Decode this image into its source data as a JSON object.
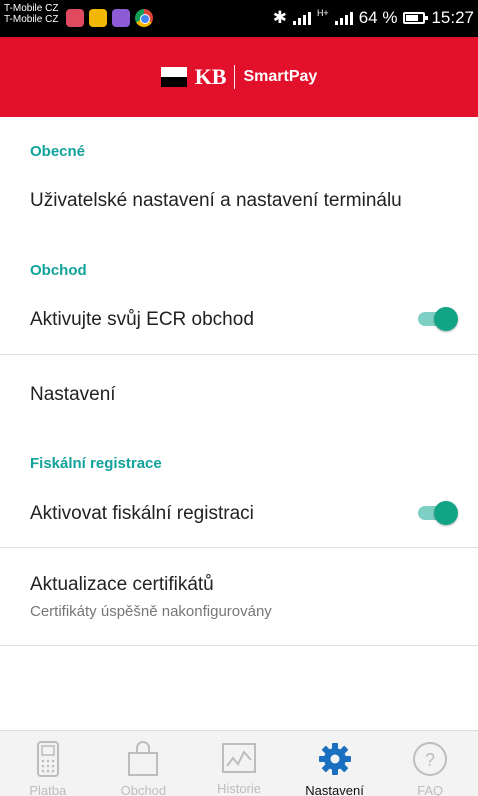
{
  "status_bar": {
    "carrier1": "T-Mobile CZ",
    "carrier2": "T-Mobile CZ",
    "network": "H+",
    "battery": "64 %",
    "battery_level": 0.64,
    "time": "15:27"
  },
  "header": {
    "logo_text": "KB",
    "product": "SmartPay",
    "color": "#e2102b"
  },
  "sections": {
    "general": {
      "title": "Obecné",
      "item": "Uživatelské nastavení a nastavení terminálu"
    },
    "shop": {
      "title": "Obchod",
      "ecr_label": "Aktivujte svůj ECR obchod",
      "ecr_enabled": true,
      "settings_label": "Nastavení"
    },
    "fiscal": {
      "title": "Fiskální registrace",
      "activate_label": "Aktivovat fiskální registraci",
      "activate_enabled": true,
      "cert_label": "Aktualizace certifikátů",
      "cert_status": "Certifikáty úspěšně nakonfigurovány"
    }
  },
  "bottom_nav": [
    {
      "label": "Platba",
      "icon": "terminal-icon",
      "active": false
    },
    {
      "label": "Obchod",
      "icon": "shopping-bag-icon",
      "active": false
    },
    {
      "label": "Historie",
      "icon": "chart-icon",
      "active": false
    },
    {
      "label": "Nastavení",
      "icon": "gear-icon",
      "active": true
    },
    {
      "label": "FAQ",
      "icon": "question-icon",
      "active": false
    }
  ],
  "colors": {
    "accent": "#11a39b",
    "toggle_on": "#11a585",
    "nav_active_icon": "#1a6fc0"
  }
}
